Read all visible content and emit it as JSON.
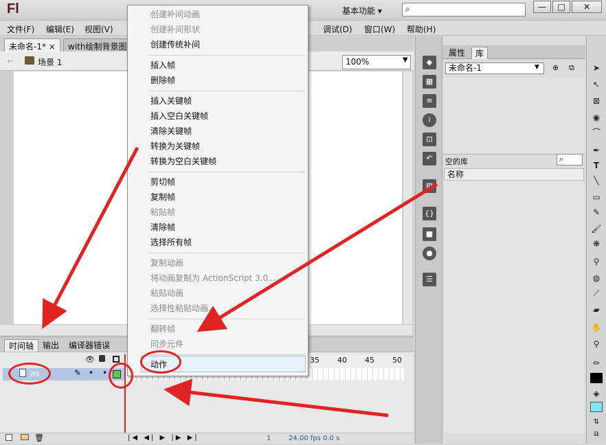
{
  "app": {
    "logo": "Fl",
    "workspace": "基本功能",
    "workspace_chevron": "▾"
  },
  "window": {
    "minimize": "—",
    "restore": "□",
    "close": "✕"
  },
  "menubar": [
    "文件(F)",
    "编辑(E)",
    "视图(V)",
    "调试(D)",
    "窗口(W)",
    "帮助(H)"
  ],
  "doc_tabs": [
    {
      "label": "未命名-1*",
      "close": "×"
    },
    {
      "label": "with绘制背景图"
    }
  ],
  "scene": {
    "label": "场景 1",
    "zoom": "100%"
  },
  "timeline": {
    "tabs": [
      "时间轴",
      "输出",
      "编译器错误"
    ],
    "layer": "as",
    "ruler": [
      "35",
      "40",
      "45",
      "50"
    ],
    "frame": "1",
    "fps": "24.00 fps",
    "time": "0.0 s"
  },
  "context_menu": {
    "items": [
      {
        "label": "创建补间动画",
        "disabled": true
      },
      {
        "label": "创建补间形状",
        "disabled": true
      },
      {
        "label": "创建传统补间",
        "disabled": false
      },
      {
        "label": "插入帧",
        "disabled": false
      },
      {
        "label": "删除帧",
        "disabled": false
      },
      {
        "label": "插入关键帧",
        "disabled": false
      },
      {
        "label": "插入空白关键帧",
        "disabled": false
      },
      {
        "label": "清除关键帧",
        "disabled": false
      },
      {
        "label": "转换为关键帧",
        "disabled": false
      },
      {
        "label": "转换为空白关键帧",
        "disabled": false
      },
      {
        "label": "剪切帧",
        "disabled": false
      },
      {
        "label": "复制帧",
        "disabled": false
      },
      {
        "label": "粘贴帧",
        "disabled": true
      },
      {
        "label": "清除帧",
        "disabled": false
      },
      {
        "label": "选择所有帧",
        "disabled": false
      },
      {
        "label": "复制动画",
        "disabled": true
      },
      {
        "label": "将动画复制为 ActionScript 3.0...",
        "disabled": true
      },
      {
        "label": "粘贴动画",
        "disabled": true
      },
      {
        "label": "选择性粘贴动画...",
        "disabled": true
      },
      {
        "label": "翻转帧",
        "disabled": true
      },
      {
        "label": "同步元件",
        "disabled": true
      },
      {
        "label": "动作",
        "disabled": false
      }
    ]
  },
  "library": {
    "tabs": [
      "属性",
      "库"
    ],
    "doc_select": "未命名-1",
    "empty_label": "空的库",
    "column_name": "名称"
  },
  "icons": {
    "search": "⌕",
    "scene": "🎬",
    "back_arrow": "←"
  },
  "colors": {
    "annotation": "#e02424",
    "layer_selected": "#b2c7e4",
    "stroke_swatch": "#000000",
    "fill_swatch": "#8ae0f5"
  }
}
